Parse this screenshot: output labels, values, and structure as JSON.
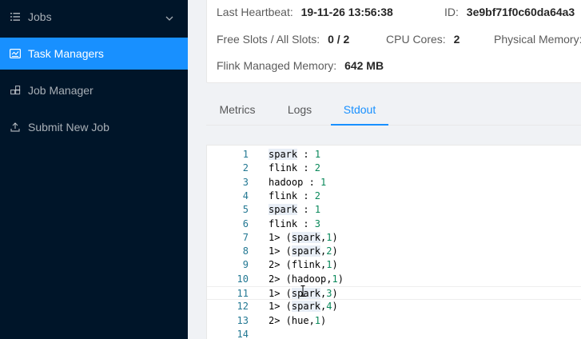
{
  "sidebar": {
    "items": [
      {
        "label": "Jobs",
        "icon": "list-icon"
      },
      {
        "label": "Task Managers",
        "icon": "dashboard-icon"
      },
      {
        "label": "Job Manager",
        "icon": "cluster-icon"
      },
      {
        "label": "Submit New Job",
        "icon": "upload-icon"
      }
    ]
  },
  "info": {
    "last_heartbeat_label": "Last Heartbeat:",
    "last_heartbeat_value": "19-11-26 13:56:38",
    "id_label": "ID:",
    "id_value": "3e9bf71f0c60da64a3",
    "slots_label": "Free Slots / All Slots:",
    "slots_value": "0 / 2",
    "cpu_label": "CPU Cores:",
    "cpu_value": "2",
    "physical_memory_label": "Physical Memory:",
    "managed_memory_label": "Flink Managed Memory:",
    "managed_memory_value": "642 MB"
  },
  "tabs": [
    {
      "label": "Metrics"
    },
    {
      "label": "Logs"
    },
    {
      "label": "Stdout"
    }
  ],
  "active_tab": "Stdout",
  "colors": {
    "sidebar_bg": "#001529",
    "accent": "#1890ff",
    "line_number": "#237893",
    "number_literal": "#09885a"
  },
  "stdout": {
    "lines": [
      {
        "n": "1",
        "pre": "",
        "hl": "spark",
        "mid": " : ",
        "num": "1",
        "post": ""
      },
      {
        "n": "2",
        "pre": "flink : ",
        "hl": "",
        "mid": "",
        "num": "2",
        "post": ""
      },
      {
        "n": "3",
        "pre": "hadoop : ",
        "hl": "",
        "mid": "",
        "num": "1",
        "post": ""
      },
      {
        "n": "4",
        "pre": "flink : ",
        "hl": "",
        "mid": "",
        "num": "2",
        "post": ""
      },
      {
        "n": "5",
        "pre": "",
        "hl": "spark",
        "mid": " : ",
        "num": "1",
        "post": ""
      },
      {
        "n": "6",
        "pre": "flink : ",
        "hl": "",
        "mid": "",
        "num": "3",
        "post": ""
      },
      {
        "n": "7",
        "pre": "1> (",
        "hl": "spark",
        "mid": ",",
        "num": "1",
        "post": ")"
      },
      {
        "n": "8",
        "pre": "1> (",
        "hl": "spark",
        "mid": ",",
        "num": "2",
        "post": ")"
      },
      {
        "n": "9",
        "pre": "2> (flink,",
        "hl": "",
        "mid": "",
        "num": "1",
        "post": ")"
      },
      {
        "n": "10",
        "pre": "2> (hadoop,",
        "hl": "",
        "mid": "",
        "num": "1",
        "post": ")"
      },
      {
        "n": "11",
        "pre": "1> (",
        "hl": "spark",
        "mid": ",",
        "num": "3",
        "post": ")"
      },
      {
        "n": "12",
        "pre": "1> (",
        "hl": "spark",
        "mid": ",",
        "num": "4",
        "post": ")"
      },
      {
        "n": "13",
        "pre": "2> (hue,",
        "hl": "",
        "mid": "",
        "num": "1",
        "post": ")"
      },
      {
        "n": "14",
        "pre": "",
        "hl": "",
        "mid": "",
        "num": "",
        "post": ""
      }
    ]
  }
}
